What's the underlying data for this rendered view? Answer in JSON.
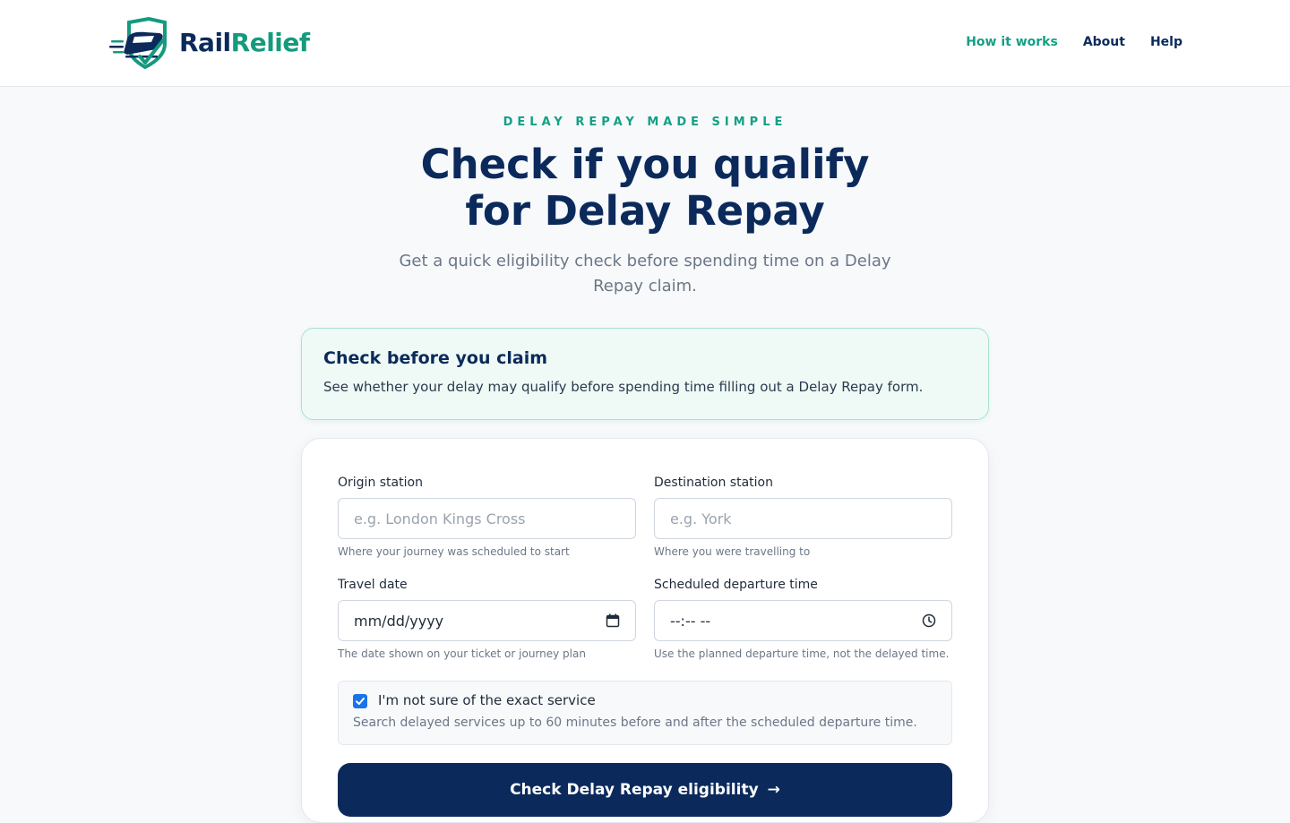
{
  "brand": {
    "name_part1": "Rail",
    "name_part2": "Relief",
    "colors": {
      "navy": "#0b2a5b",
      "teal": "#14a085"
    }
  },
  "nav": {
    "items": [
      {
        "label": "How it works",
        "active": true
      },
      {
        "label": "About",
        "active": false
      },
      {
        "label": "Help",
        "active": false
      }
    ]
  },
  "hero": {
    "eyebrow": "DELAY REPAY MADE SIMPLE",
    "title_line1": "Check if you qualify",
    "title_line2": "for Delay Repay",
    "subtitle": "Get a quick eligibility check before spending time on a Delay Repay claim."
  },
  "info_card": {
    "title": "Check before you claim",
    "text": "See whether your delay may qualify before spending time filling out a Delay Repay form."
  },
  "form": {
    "origin": {
      "label": "Origin station",
      "placeholder": "e.g. London Kings Cross",
      "hint": "Where your journey was scheduled to start"
    },
    "destination": {
      "label": "Destination station",
      "placeholder": "e.g. York",
      "hint": "Where you were travelling to"
    },
    "date": {
      "label": "Travel date",
      "value": "mm/dd/yyyy",
      "icon": "calendar-icon",
      "hint": "The date shown on your ticket or journey plan"
    },
    "time": {
      "label": "Scheduled departure time",
      "value": "--:-- --",
      "icon": "clock-icon",
      "hint": "Use the planned departure time, not the delayed time."
    },
    "unsure": {
      "checked": true,
      "label": "I'm not sure of the exact service",
      "hint": "Search delayed services up to 60 minutes before and after the scheduled departure time."
    },
    "submit": {
      "label": "Check Delay Repay eligibility",
      "arrow": "→"
    }
  }
}
